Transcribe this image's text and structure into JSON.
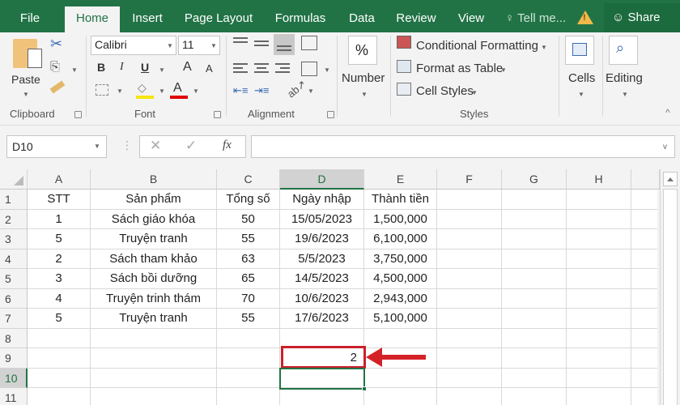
{
  "tabs": [
    {
      "label": "File",
      "active": false
    },
    {
      "label": "Home",
      "active": true
    },
    {
      "label": "Insert",
      "active": false
    },
    {
      "label": "Page Layout",
      "active": false
    },
    {
      "label": "Formulas",
      "active": false
    },
    {
      "label": "Data",
      "active": false
    },
    {
      "label": "Review",
      "active": false
    },
    {
      "label": "View",
      "active": false
    }
  ],
  "tell_me": "Tell me...",
  "share_label": "Share",
  "ribbon": {
    "clipboard": {
      "paste_label": "Paste",
      "group_label": "Clipboard"
    },
    "font": {
      "font_name": "Calibri",
      "font_size": "11",
      "bold": "B",
      "italic": "I",
      "underline": "U",
      "grow": "A",
      "shrink": "A",
      "color_letter": "A",
      "group_label": "Font"
    },
    "alignment": {
      "group_label": "Alignment"
    },
    "number": {
      "icon": "%",
      "label": "Number"
    },
    "styles": {
      "conditional_formatting": "Conditional Formatting",
      "format_as_table": "Format as Table",
      "cell_styles": "Cell Styles",
      "group_label": "Styles"
    },
    "cells": {
      "label": "Cells"
    },
    "editing": {
      "label": "Editing"
    },
    "colors": {
      "highlight": "#f5e50f",
      "font_color": "#e00000"
    }
  },
  "formula_bar": {
    "name_box": "D10",
    "cancel": "✕",
    "enter": "✓",
    "fx": "fx",
    "formula": ""
  },
  "grid": {
    "columns": [
      "A",
      "B",
      "C",
      "D",
      "E",
      "F",
      "G",
      "H"
    ],
    "selected_column": "D",
    "rows": [
      "1",
      "2",
      "3",
      "4",
      "5",
      "6",
      "7",
      "8",
      "9",
      "10",
      "11"
    ],
    "selected_row": "10",
    "headers": [
      "STT",
      "Sản phẩm",
      "Tổng số",
      "Ngày nhập",
      "Thành tiền"
    ],
    "data": [
      [
        "1",
        "Sách giáo khóa",
        "50",
        "15/05/2023",
        "1,500,000"
      ],
      [
        "5",
        "Truyện tranh",
        "55",
        "19/6/2023",
        "6,100,000"
      ],
      [
        "2",
        "Sách tham khảo",
        "63",
        "5/5/2023",
        "3,750,000"
      ],
      [
        "3",
        "Sách bồi dưỡng",
        "65",
        "14/5/2023",
        "4,500,000"
      ],
      [
        "4",
        "Truyện trinh thám",
        "70",
        "10/6/2023",
        "2,943,000"
      ],
      [
        "5",
        "Truyện tranh",
        "55",
        "17/6/2023",
        "5,100,000"
      ]
    ],
    "d9_value": "2",
    "active_cell": "D10",
    "highlighted_cell": "D9"
  },
  "annotation": {
    "color": "#d42128"
  }
}
